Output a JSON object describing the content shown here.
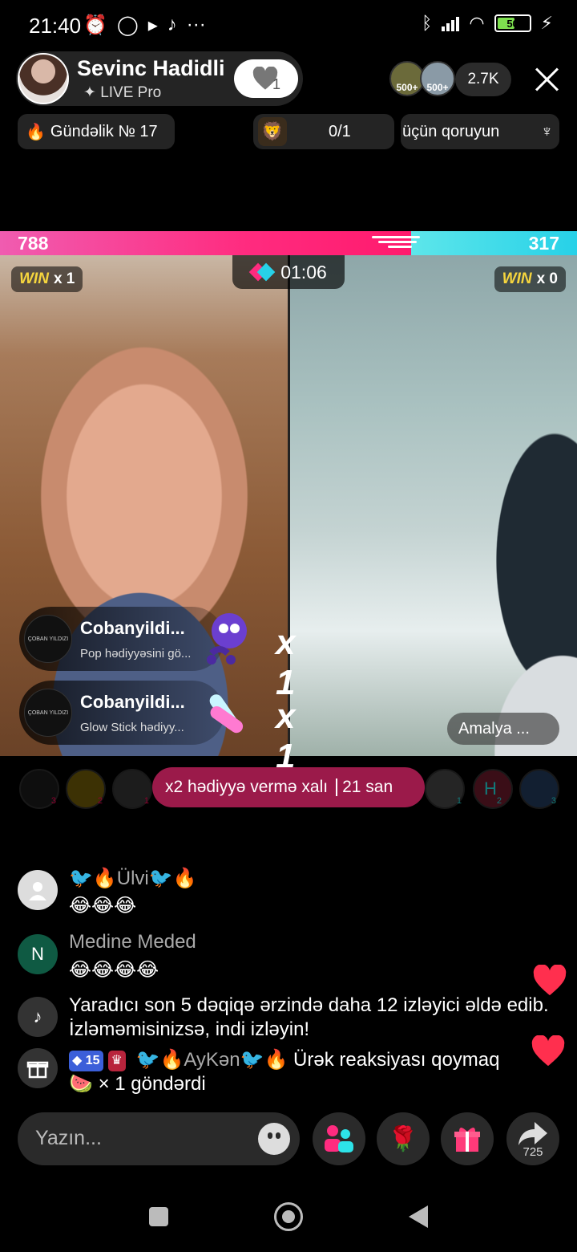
{
  "status_bar": {
    "time": "21:40",
    "battery": "50",
    "icons": [
      "alarm-icon",
      "whatsapp-icon",
      "play-icon",
      "tiktok-icon",
      "more-icon",
      "bluetooth-icon",
      "signal-icon",
      "wifi-icon",
      "battery-icon",
      "charging-icon"
    ]
  },
  "host": {
    "name": "Sevinc Hadidli",
    "subtitle": "LIVE Pro",
    "likes": "1"
  },
  "viewers": {
    "top": [
      "500+",
      "500+"
    ],
    "count": "2.7K"
  },
  "chips": {
    "daily": "Gündəlik № 17",
    "goal": "0/1",
    "protect": "üçün qoruyun"
  },
  "battle": {
    "left_score": "788",
    "right_score": "317",
    "left_score_fraction": 0.713,
    "timer": "01:06",
    "win_label": "WIN",
    "left_win": "x 1",
    "right_win": "x 0"
  },
  "gifts": [
    {
      "user": "Cobanyildi...",
      "desc": "Pop  hədiyyəsini gö...",
      "mult": "x 1",
      "avatar_text": "ÇOBAN YILDIZI"
    },
    {
      "user": "Cobanyildi...",
      "desc": "Glow Stick  hədiyy...",
      "mult": "x 1",
      "avatar_text": "ÇOBAN YILDIZI"
    }
  ],
  "opponent_name": "Amalya ...",
  "boost": {
    "text": "x2 hədiyyə vermə xalı",
    "seconds": "21 san"
  },
  "supporters_left": [
    "3",
    "2",
    "1"
  ],
  "supporters_right": [
    "1",
    "2",
    "3"
  ],
  "supporter_letter": "H",
  "chat": [
    {
      "user": "🐦🔥Ülvi🐦🔥",
      "text": "😂😂😂"
    },
    {
      "user": "Medine Meded",
      "avatar_letter": "N",
      "text": "😂😂😂😂"
    },
    {
      "text": "Yaradıcı son 5 dəqiqə ərzində daha 12 izləyici əldə edib. İzləməmisinizsə, indi izləyin!"
    },
    {
      "badge_level": "15",
      "user": "🐦🔥AyKən🐦🔥",
      "text_1": "Ürək reaksiyası qoymaq",
      "text_2": "× 1 göndərdi"
    }
  ],
  "input": {
    "placeholder": "Yazın..."
  },
  "share_count": "725",
  "colors": {
    "left_team": "#ff2b7f",
    "right_team": "#27d1e8",
    "boost_bg": "#9b1a4a",
    "heart": "#ff2f4e"
  }
}
